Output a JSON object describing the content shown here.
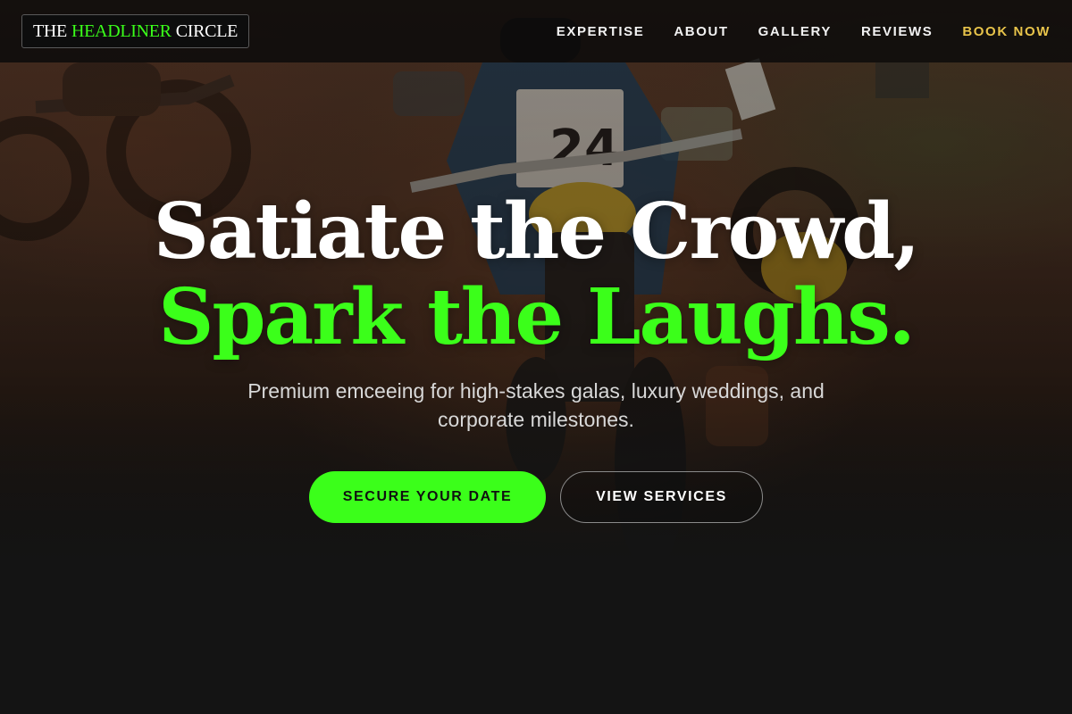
{
  "brand": {
    "part1": "THE",
    "part2": "HEADLINER",
    "part3": "CIRCLE"
  },
  "nav": {
    "items": [
      {
        "label": "EXPERTISE"
      },
      {
        "label": "ABOUT"
      },
      {
        "label": "GALLERY"
      },
      {
        "label": "REVIEWS"
      }
    ],
    "cta": "BOOK NOW"
  },
  "hero": {
    "headline_line1": "Satiate the Crowd,",
    "headline_line2": "Spark the Laughs.",
    "subtitle": "Premium emceeing for high-stakes galas, luxury weddings, and corporate milestones.",
    "primary_button": "SECURE YOUR DATE",
    "secondary_button": "VIEW SERVICES",
    "race_number": "24"
  },
  "colors": {
    "accent_green": "#3bff1a",
    "cta_gold": "#e8c44a",
    "background": "#141414"
  }
}
